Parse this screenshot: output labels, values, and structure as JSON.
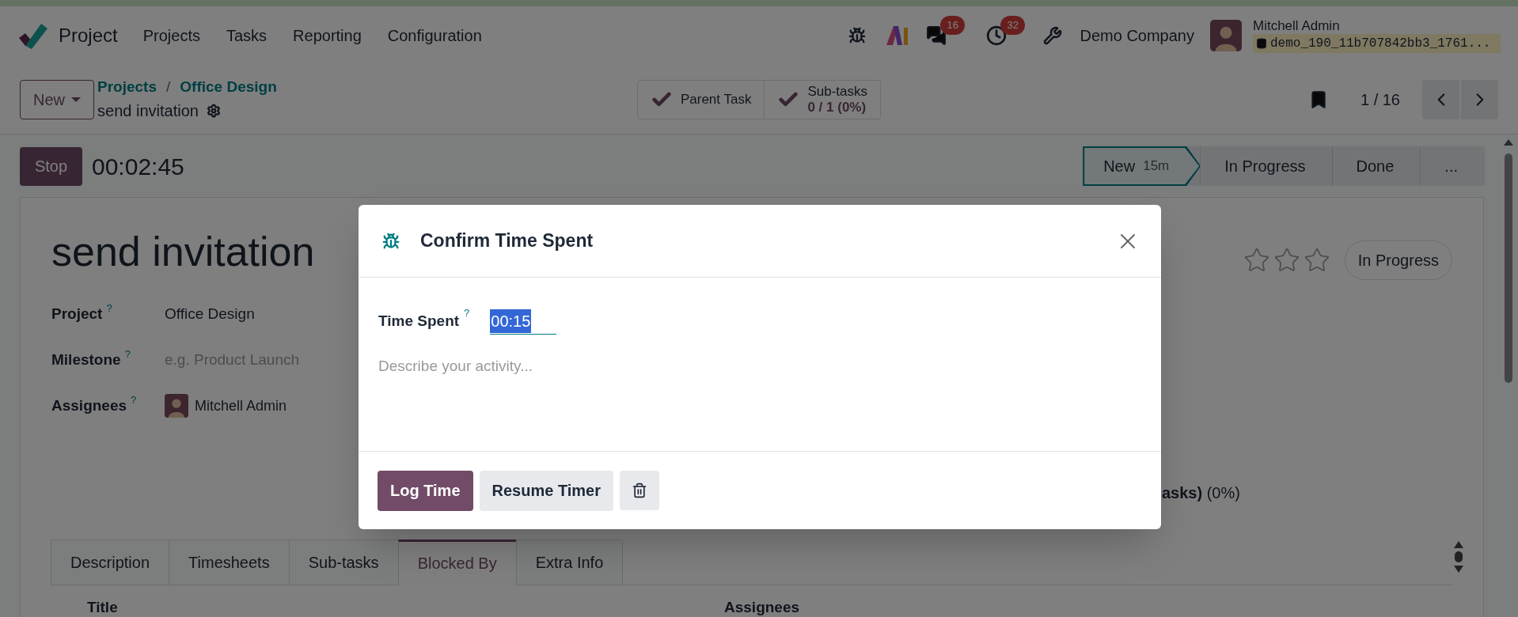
{
  "navbar": {
    "app_name": "Project",
    "menu": [
      "Projects",
      "Tasks",
      "Reporting",
      "Configuration"
    ],
    "messages_badge": "16",
    "activities_badge": "32",
    "company": "Demo Company",
    "user_name": "Mitchell Admin",
    "database": "demo_190_11b707842bb3_1761..."
  },
  "control_panel": {
    "new_button": "New",
    "breadcrumbs": [
      "Projects",
      "Office Design"
    ],
    "breadcrumb_separator": "/",
    "record_name": "send invitation",
    "smart_buttons": [
      {
        "label": "Parent Task"
      },
      {
        "label": "Sub-tasks",
        "value": "0 / 1 (0%)"
      }
    ],
    "pager": "1 / 16"
  },
  "timer": {
    "stop_button": "Stop",
    "elapsed": "00:02:45"
  },
  "stages": [
    {
      "label": "New",
      "duration": "15m",
      "selected": true
    },
    {
      "label": "In Progress",
      "selected": false
    },
    {
      "label": "Done",
      "selected": false
    },
    {
      "label": "...",
      "selected": false
    }
  ],
  "form": {
    "title": "send invitation",
    "stars": 0,
    "state_button": "In Progress",
    "fields": [
      {
        "label": "Project",
        "help": "?",
        "kind": "text",
        "value": "Office Design"
      },
      {
        "label": "Milestone",
        "help": "?",
        "kind": "placeholder",
        "placeholder": "e.g. Product Launch"
      },
      {
        "label": "Assignees",
        "help": "?",
        "kind": "avatar",
        "value": "Mitchell Admin"
      }
    ],
    "partial_text": "**asks)** (0%)",
    "tabs": [
      {
        "label": "Description",
        "selected": false
      },
      {
        "label": "Timesheets",
        "selected": false
      },
      {
        "label": "Sub-tasks",
        "selected": false
      },
      {
        "label": "Blocked By",
        "selected": true
      },
      {
        "label": "Extra Info",
        "selected": false
      }
    ],
    "table_columns": [
      "Title",
      "Assignees"
    ]
  },
  "dialog": {
    "title": "Confirm Time Spent",
    "field_label": "Time Spent",
    "field_help": "?",
    "time_value": "00:15",
    "description_placeholder": "Describe your activity...",
    "buttons": [
      {
        "kind": "primary",
        "label": "Log Time"
      },
      {
        "kind": "secondary",
        "label": "Resume Timer"
      },
      {
        "kind": "delete"
      }
    ]
  }
}
